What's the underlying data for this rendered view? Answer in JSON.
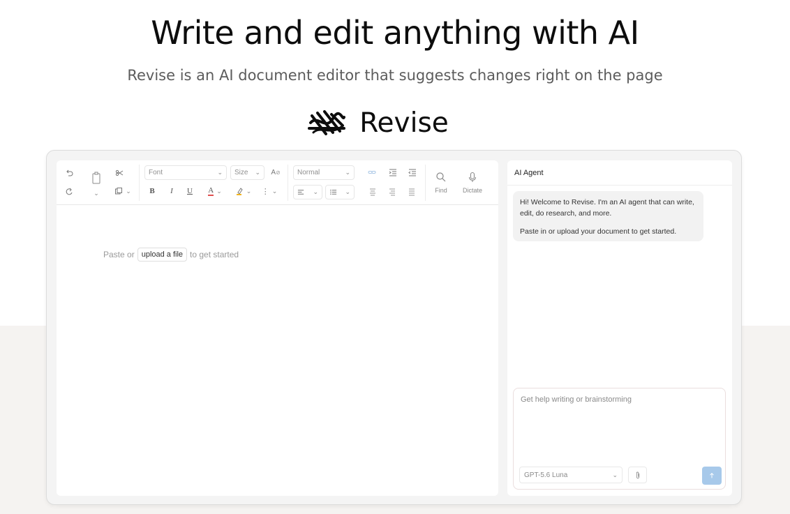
{
  "hero": {
    "title": "Write and edit anything with AI",
    "subtitle": "Revise is an AI document editor that suggests changes right on the page"
  },
  "brand": {
    "name": "Revise",
    "logo_icon": "scribble-logo-icon"
  },
  "toolbar": {
    "font_select": "Font",
    "size_select": "Size",
    "style_select": "Normal",
    "bold": "B",
    "italic": "I",
    "underline": "U",
    "font_color": "A",
    "find_label": "Find",
    "dictate_label": "Dictate",
    "icons": [
      "undo-icon",
      "redo-icon",
      "paste-icon",
      "cut-icon",
      "copy-icon",
      "clear-format-icon",
      "link-icon",
      "indent-icon",
      "outdent-icon",
      "search-icon",
      "microphone-icon"
    ]
  },
  "editor": {
    "placeholder_before": "Paste or",
    "upload_label": "upload a file",
    "placeholder_after": "to get started"
  },
  "agent": {
    "header": "AI Agent",
    "messages": [
      "Hi! Welcome to Revise. I'm an AI agent that can write, edit, do research, and more.",
      "Paste in or upload your document to get started."
    ],
    "input_placeholder": "Get help writing or brainstorming",
    "model": "GPT-5.6 Luna"
  },
  "colors": {
    "send_button": "#a7c9ea",
    "lower_background": "#f5f3f1",
    "bubble": "#f2f2f2"
  }
}
